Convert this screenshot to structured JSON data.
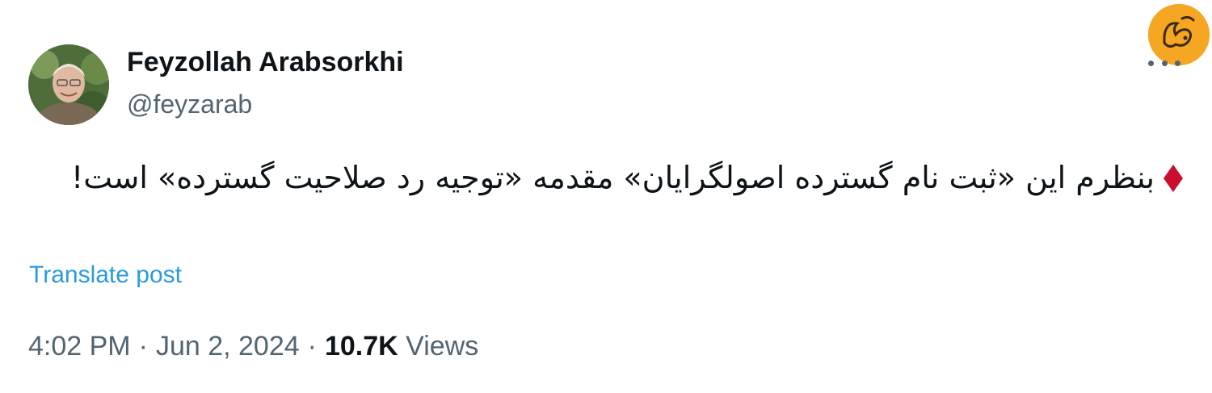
{
  "author": {
    "name": "Feyzollah Arabsorkhi",
    "handle": "@feyzarab"
  },
  "tweet": {
    "text_line": "بنظرم این «ثبت نام گسترده اصولگرایان» مقدمه «توجیه رد صلاحیت گسترده» است!",
    "bullet_icon": "red-diamond-icon",
    "bullet_color": "#c8102e"
  },
  "translate": {
    "label": "Translate post"
  },
  "meta": {
    "time": "4:02 PM",
    "date": "Jun 2, 2024",
    "separator": "·",
    "views_count": "10.7K",
    "views_label": "Views"
  },
  "logo": {
    "icon": "publisher-logo-icon",
    "color": "#f5a623"
  },
  "more": {
    "icon": "more-options-icon"
  }
}
